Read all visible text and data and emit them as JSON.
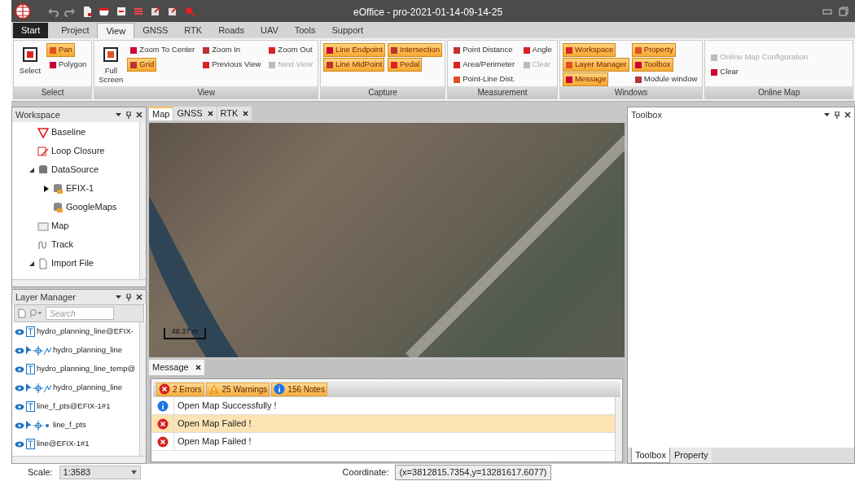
{
  "window": {
    "title": "eOffice - pro-2021-01-14-09-14-25"
  },
  "menu_tabs": [
    {
      "label": "Start",
      "selected": false,
      "kind": "start"
    },
    {
      "label": "Project",
      "selected": false,
      "kind": "tab"
    },
    {
      "label": "View",
      "selected": true,
      "kind": "tab"
    },
    {
      "label": "GNSS",
      "selected": false,
      "kind": "tab"
    },
    {
      "label": "RTK",
      "selected": false,
      "kind": "tab"
    },
    {
      "label": "Roads",
      "selected": false,
      "kind": "tab"
    },
    {
      "label": "UAV",
      "selected": false,
      "kind": "tab"
    },
    {
      "label": "Tools",
      "selected": false,
      "kind": "tab"
    },
    {
      "label": "Support",
      "selected": false,
      "kind": "tab"
    }
  ],
  "ribbon_groups": [
    {
      "label": "Select",
      "columns": [
        [
          {
            "label": "Select",
            "kind": "large",
            "disabled": false
          }
        ],
        [
          {
            "label": "Pan",
            "kind": "small",
            "active": true,
            "disabled": false
          },
          {
            "label": "Polygon",
            "kind": "small",
            "active": false,
            "disabled": false
          }
        ]
      ]
    },
    {
      "label": "View",
      "columns": [
        [
          {
            "label": "Full Screen",
            "kind": "large",
            "disabled": false
          }
        ],
        [
          {
            "label": "Zoom To Center",
            "kind": "small",
            "active": false,
            "disabled": false
          },
          {
            "label": "Grid",
            "kind": "small",
            "active": true,
            "disabled": false
          }
        ],
        [
          {
            "label": "Zoom In",
            "kind": "small",
            "active": false,
            "disabled": false
          },
          {
            "label": "Previous View",
            "kind": "small",
            "active": false,
            "disabled": false
          }
        ],
        [
          {
            "label": "Zoom Out",
            "kind": "small",
            "active": false,
            "disabled": false
          },
          {
            "label": "Next View",
            "kind": "small",
            "active": false,
            "disabled": true
          }
        ]
      ]
    },
    {
      "label": "Capture",
      "columns": [
        [
          {
            "label": "Line Endpoint",
            "kind": "small",
            "active": true,
            "disabled": false
          },
          {
            "label": "Line MidPoint",
            "kind": "small",
            "active": true,
            "disabled": false
          }
        ],
        [
          {
            "label": "Intersection",
            "kind": "small",
            "active": true,
            "disabled": false
          },
          {
            "label": "Pedal",
            "kind": "small",
            "active": true,
            "disabled": false
          }
        ]
      ]
    },
    {
      "label": "Measurement",
      "columns": [
        [
          {
            "label": "Point Distance",
            "kind": "small",
            "active": false,
            "disabled": false
          },
          {
            "label": "Area/Perimeter",
            "kind": "small",
            "active": false,
            "disabled": false
          },
          {
            "label": "Point-Line Dist.",
            "kind": "small",
            "active": false,
            "disabled": false
          }
        ],
        [
          {
            "label": "Angle",
            "kind": "small",
            "active": false,
            "disabled": false
          },
          {
            "label": "Clear",
            "kind": "small",
            "active": false,
            "disabled": true
          }
        ]
      ]
    },
    {
      "label": "Windows",
      "columns": [
        [
          {
            "label": "Workspace",
            "kind": "small",
            "active": true,
            "disabled": false
          },
          {
            "label": "Layer Manager",
            "kind": "small",
            "active": true,
            "disabled": false
          },
          {
            "label": "Message",
            "kind": "small",
            "active": true,
            "disabled": false
          }
        ],
        [
          {
            "label": "Property",
            "kind": "small",
            "active": true,
            "disabled": false
          },
          {
            "label": "Toolbox",
            "kind": "small",
            "active": true,
            "disabled": false
          },
          {
            "label": "Module window",
            "kind": "small",
            "active": false,
            "disabled": false
          }
        ]
      ]
    },
    {
      "label": "Online Map",
      "columns": [
        [
          {
            "label": "Online Map Configuration",
            "kind": "small",
            "active": false,
            "disabled": true
          },
          {
            "label": "Clear",
            "kind": "small",
            "active": false,
            "disabled": false
          }
        ]
      ]
    }
  ],
  "workspace": {
    "title": "Workspace",
    "items": [
      {
        "label": "Baseline"
      },
      {
        "label": "Loop Closure"
      },
      {
        "label": "DataSource",
        "expanded": true,
        "children": [
          {
            "label": "EFIX-1",
            "expanded": false
          },
          {
            "label": "GoogleMaps"
          }
        ]
      },
      {
        "label": "Map"
      },
      {
        "label": "Track"
      },
      {
        "label": "Import File",
        "expanded": true
      }
    ]
  },
  "layer_manager": {
    "title": "Layer Manager",
    "search": {
      "placeholder": "Search"
    },
    "layers": [
      {
        "kind": "text",
        "label": "hydro_planning_line@EFIX-"
      },
      {
        "kind": "line",
        "label": "hydro_planning_line"
      },
      {
        "kind": "text",
        "label": "hydro_planning_line_temp@"
      },
      {
        "kind": "line",
        "label": "hydro_planning_line"
      },
      {
        "kind": "text",
        "label": "line_f_pts@EFIX-1#1"
      },
      {
        "kind": "point",
        "label": "line_f_pts"
      },
      {
        "kind": "text",
        "label": "line@EFIX-1#1"
      }
    ]
  },
  "documents": {
    "tabs": [
      {
        "label": "Map",
        "selected": true,
        "closable": false
      },
      {
        "label": "GNSS",
        "selected": false,
        "closable": true
      },
      {
        "label": "RTK",
        "selected": false,
        "closable": true
      }
    ],
    "map": {
      "scale_bar": "48.37 m"
    }
  },
  "message": {
    "tab": "Message",
    "filters": [
      {
        "kind": "error",
        "label": "2 Errors"
      },
      {
        "kind": "warning",
        "label": "25 Warnings"
      },
      {
        "kind": "info",
        "label": "156 Notes"
      }
    ],
    "rows": [
      {
        "kind": "info",
        "text": "Open Map Successfully !",
        "selected": false
      },
      {
        "kind": "error",
        "text": "Open Map Failed !",
        "selected": true
      },
      {
        "kind": "error",
        "text": "Open Map Failed !",
        "selected": false
      }
    ]
  },
  "toolbox": {
    "title": "Toolbox",
    "tabs": [
      {
        "label": "Toolbox",
        "selected": true
      },
      {
        "label": "Property",
        "selected": false
      }
    ]
  },
  "status_bar": {
    "scale_label": "Scale:",
    "scale": "1:3583",
    "coordinate_label": "Coordinate:",
    "coordinate": "(x=3812815.7354,y=13281617.6077)"
  }
}
